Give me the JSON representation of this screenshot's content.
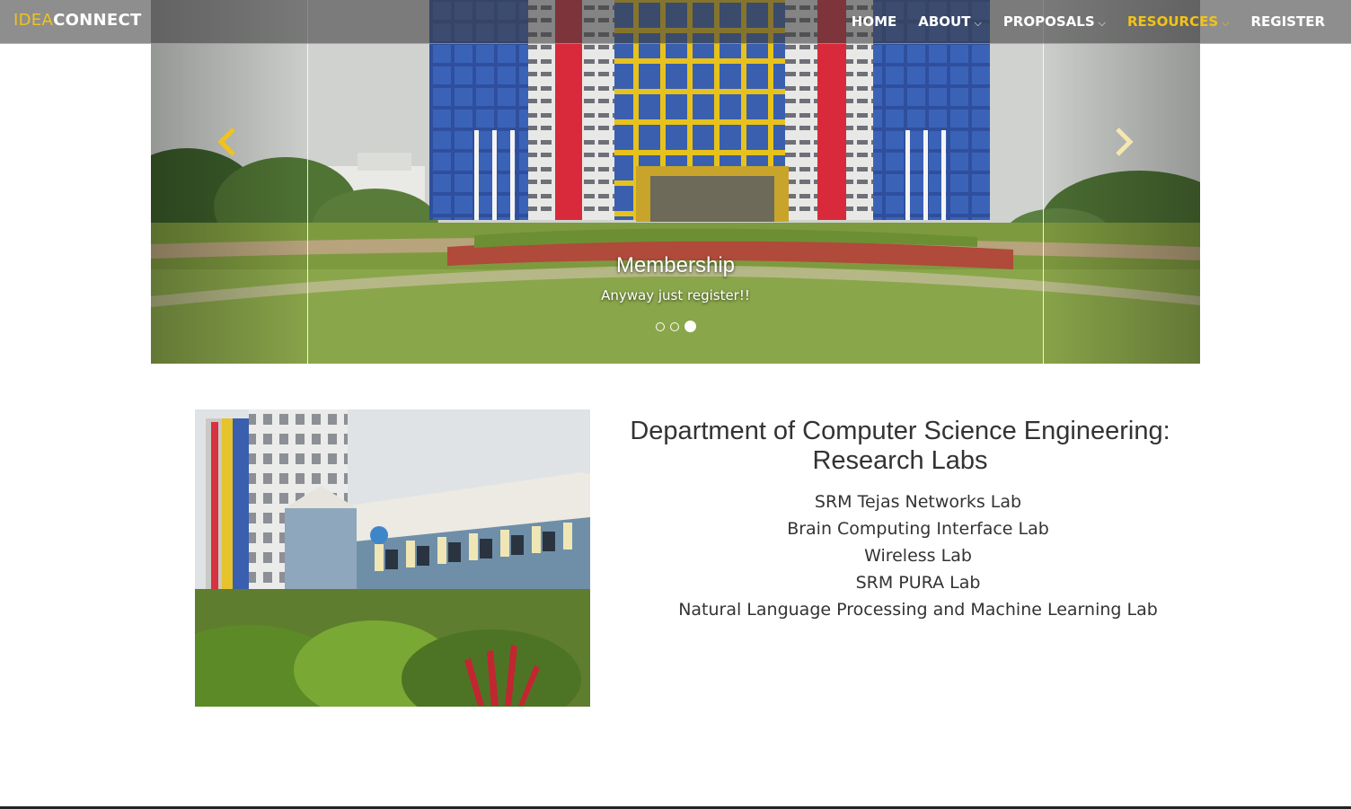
{
  "navbar": {
    "brand_part1": "IDEA",
    "brand_part2": "CONNECT",
    "items": [
      {
        "label": "HOME",
        "dropdown": false,
        "active": false
      },
      {
        "label": "ABOUT",
        "dropdown": true,
        "active": false
      },
      {
        "label": "PROPOSALS",
        "dropdown": true,
        "active": false
      },
      {
        "label": "RESOURCES",
        "dropdown": true,
        "active": true
      },
      {
        "label": "REGISTER",
        "dropdown": false,
        "active": false
      }
    ],
    "dropdown_caret": "⌵",
    "accent_color": "#f2c318"
  },
  "carousel": {
    "caption_title": "Membership",
    "caption_text": "Anyway just register!!",
    "slide_count": 3,
    "active_slide": 3,
    "prev_icon": "chevron-left-icon",
    "next_icon": "chevron-right-icon"
  },
  "department": {
    "title": "Department of Computer Science Engineering: Research Labs",
    "labs": [
      "SRM Tejas Networks Lab",
      "Brain Computing Interface Lab",
      "Wireless Lab",
      "SRM PURA Lab",
      "Natural Language Processing and Machine Learning Lab"
    ]
  }
}
